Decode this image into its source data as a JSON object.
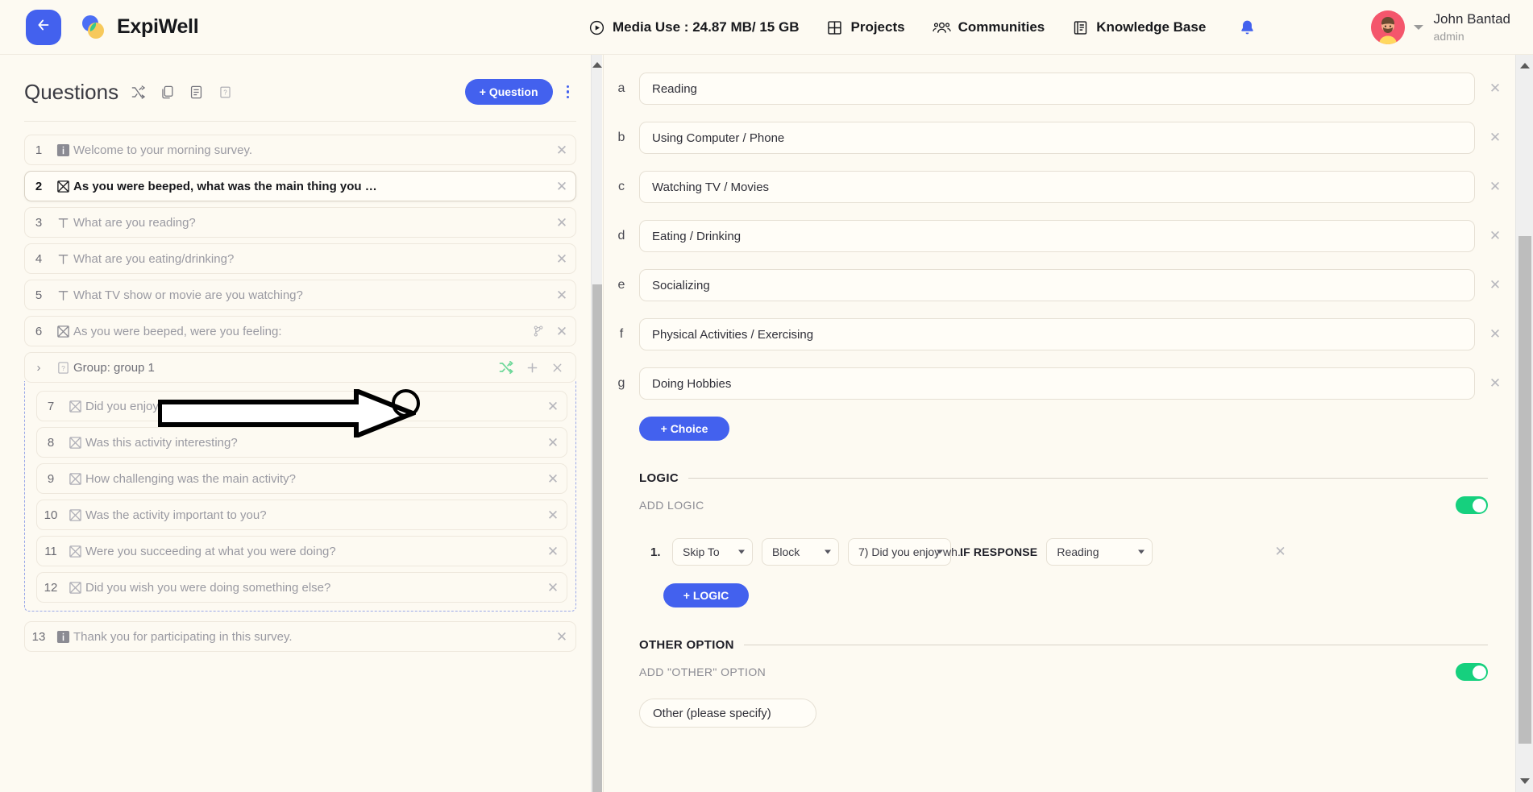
{
  "topbar": {
    "back_icon": "back-arrow-icon",
    "brand": "ExpiWell",
    "nav": [
      {
        "icon": "media-play-icon",
        "label": "Media Use : 24.87 MB/ 15 GB"
      },
      {
        "icon": "grid-icon",
        "label": "Projects"
      },
      {
        "icon": "people-icon",
        "label": "Communities"
      },
      {
        "icon": "book-icon",
        "label": "Knowledge Base"
      }
    ],
    "bell_icon": "notification-bell-icon",
    "user": {
      "name": "John Bantad",
      "role": "admin"
    }
  },
  "questions_panel": {
    "title": "Questions",
    "header_icons": [
      "shuffle-icon",
      "copy-icon",
      "list-icon",
      "help-icon"
    ],
    "add_question_label": "+ Question",
    "kebab_icon": "more-options-icon",
    "items": [
      {
        "num": "1",
        "type": "info",
        "text": "Welcome to your morning survey.",
        "selected": false,
        "has_logic": false
      },
      {
        "num": "2",
        "type": "choice",
        "text": "As you were beeped, what was the main thing you …",
        "selected": true,
        "has_logic": false
      },
      {
        "num": "3",
        "type": "text",
        "text": "What are you reading?",
        "selected": false,
        "has_logic": false
      },
      {
        "num": "4",
        "type": "text",
        "text": "What are you eating/drinking?",
        "selected": false,
        "has_logic": false
      },
      {
        "num": "5",
        "type": "text",
        "text": "What TV show or movie are you watching?",
        "selected": false,
        "has_logic": false
      },
      {
        "num": "6",
        "type": "choice",
        "text": "As you were beeped, were you feeling:",
        "selected": false,
        "has_logic": true
      }
    ],
    "group": {
      "chevron_icon": "chevron-right-icon",
      "type_icon": "question-mark-icon",
      "label": "Group: group 1",
      "actions": [
        "shuffle-icon",
        "plus-icon",
        "close-icon"
      ],
      "items": [
        {
          "num": "7",
          "type": "choice",
          "text": "Did you enjoy what you were doing?"
        },
        {
          "num": "8",
          "type": "choice",
          "text": "Was this activity interesting?"
        },
        {
          "num": "9",
          "type": "choice",
          "text": "How challenging was the main activity?"
        },
        {
          "num": "10",
          "type": "choice",
          "text": "Was the activity important to you?"
        },
        {
          "num": "11",
          "type": "choice",
          "text": "Were you succeeding at what you were doing?"
        },
        {
          "num": "12",
          "type": "choice",
          "text": "Did you wish you were doing something else?"
        }
      ]
    },
    "items_after": [
      {
        "num": "13",
        "type": "info",
        "text": "Thank you for participating in this survey.",
        "selected": false,
        "has_logic": false
      }
    ]
  },
  "editor": {
    "choices": [
      {
        "letter": "a",
        "value": "Reading"
      },
      {
        "letter": "b",
        "value": "Using Computer / Phone"
      },
      {
        "letter": "c",
        "value": "Watching TV / Movies"
      },
      {
        "letter": "d",
        "value": "Eating / Drinking"
      },
      {
        "letter": "e",
        "value": "Socializing"
      },
      {
        "letter": "f",
        "value": "Physical Activities / Exercising"
      },
      {
        "letter": "g",
        "value": "Doing Hobbies"
      }
    ],
    "add_choice_label": "+ Choice",
    "logic": {
      "section_title": "LOGIC",
      "add_logic_toggle_label": "ADD LOGIC",
      "toggle_on": true,
      "rules": [
        {
          "index": "1.",
          "action": "Skip To",
          "target_type": "Block",
          "target": "7) Did you enjoy wh...",
          "condition_label": "IF RESPONSE",
          "condition_value": "Reading"
        }
      ],
      "add_logic_button": "+ LOGIC"
    },
    "other_option": {
      "section_title": "OTHER OPTION",
      "add_other_label": "ADD \"OTHER\" OPTION",
      "toggle_on": true,
      "input_value": "Other (please specify)"
    }
  },
  "colors": {
    "accent": "#4361ee",
    "toggle_on": "#16d07e",
    "page_bg": "#fdfaf2",
    "annotation": "#000000",
    "group_highlight": "#6fd89a"
  }
}
